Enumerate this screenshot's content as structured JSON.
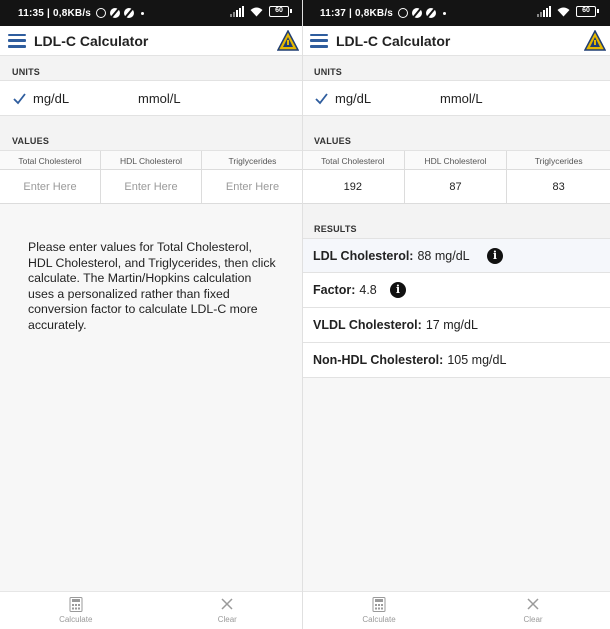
{
  "screens": [
    {
      "status": {
        "time_info": "11:35 | 0,8KB/s",
        "battery": "60"
      },
      "app_title": "LDL-C Calculator",
      "units_label": "UNITS",
      "units": [
        "mg/dL",
        "mmol/L"
      ],
      "selected_unit": "mg/dL",
      "values_label": "VALUES",
      "columns": [
        "Total Cholesterol",
        "HDL Cholesterol",
        "Triglycerides"
      ],
      "placeholder": "Enter Here",
      "inputs": [
        "",
        "",
        ""
      ],
      "instructions": "Please enter values for Total Cholesterol, HDL Cholesterol, and Triglycerides, then click calculate. The Martin/Hopkins calculation uses a personalized rather than fixed conversion factor to calculate LDL-C more accurately.",
      "nav": {
        "calculate": "Calculate",
        "clear": "Clear"
      }
    },
    {
      "status": {
        "time_info": "11:37 | 0,8KB/s",
        "battery": "60"
      },
      "app_title": "LDL-C Calculator",
      "units_label": "UNITS",
      "units": [
        "mg/dL",
        "mmol/L"
      ],
      "selected_unit": "mg/dL",
      "values_label": "VALUES",
      "columns": [
        "Total Cholesterol",
        "HDL Cholesterol",
        "Triglycerides"
      ],
      "placeholder": "Enter Here",
      "inputs": [
        "192",
        "87",
        "83"
      ],
      "results_label": "RESULTS",
      "results": [
        {
          "label": "LDL Cholesterol:",
          "value": "88 mg/dL"
        },
        {
          "label": "Factor:",
          "value": "4.8"
        },
        {
          "label": "VLDL Cholesterol:",
          "value": "17 mg/dL"
        },
        {
          "label": "Non-HDL Cholesterol:",
          "value": "105 mg/dL"
        }
      ],
      "nav": {
        "calculate": "Calculate",
        "clear": "Clear"
      }
    }
  ],
  "colors": {
    "accent": "#2f5d9e",
    "statusbar": "#141414",
    "logo_gold": "#e6b800"
  },
  "icons": [
    "menu-icon",
    "logo-icon",
    "check-icon",
    "info-icon",
    "calculator-icon",
    "close-icon"
  ]
}
